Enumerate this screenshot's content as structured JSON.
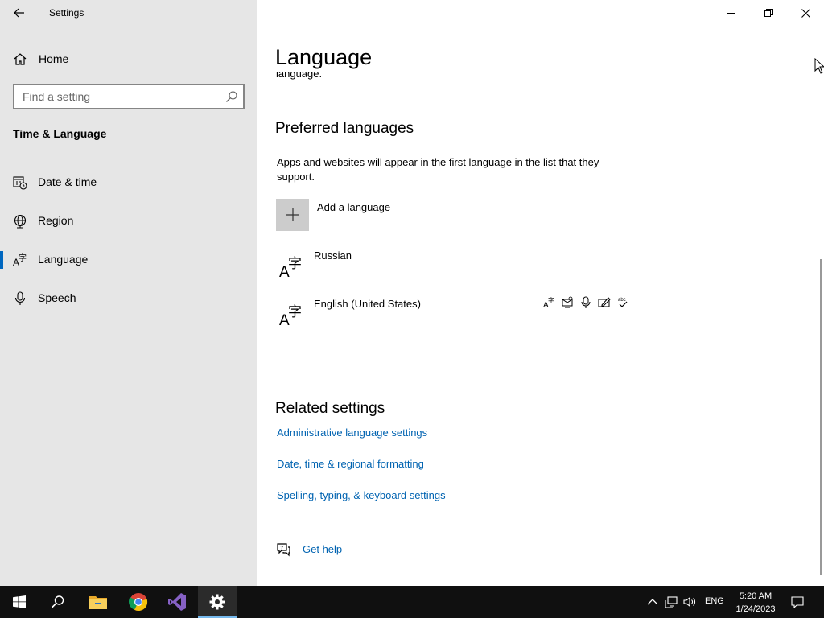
{
  "window": {
    "app_title": "Settings"
  },
  "sidebar": {
    "home_label": "Home",
    "search_placeholder": "Find a setting",
    "section_title": "Time & Language",
    "items": [
      {
        "label": "Date & time",
        "icon": "calendar-clock-icon"
      },
      {
        "label": "Region",
        "icon": "globe-icon"
      },
      {
        "label": "Language",
        "icon": "language-icon",
        "selected": true
      },
      {
        "label": "Speech",
        "icon": "microphone-icon"
      }
    ]
  },
  "main": {
    "page_title": "Language",
    "clipped_text": "language.",
    "preferred": {
      "heading": "Preferred languages",
      "description": "Apps and websites will appear in the first language in the list that they support.",
      "add_label": "Add a language",
      "languages": [
        {
          "name": "Russian"
        },
        {
          "name": "English (United States)",
          "features": [
            "display-language-icon",
            "text-to-speech-icon",
            "speech-recognition-icon",
            "handwriting-icon",
            "spell-check-icon"
          ]
        }
      ]
    },
    "related": {
      "heading": "Related settings",
      "links": [
        "Administrative language settings",
        "Date, time & regional formatting",
        "Spelling, typing, & keyboard settings"
      ]
    },
    "help_label": "Get help"
  },
  "taskbar": {
    "apps": [
      "start-icon",
      "search-icon",
      "file-explorer-icon",
      "chrome-icon",
      "visual-studio-icon",
      "settings-gear-icon"
    ],
    "active_app": "settings-gear-icon",
    "language": "ENG",
    "time": "5:20 AM",
    "date": "1/24/2023"
  },
  "colors": {
    "sidebar_bg": "#e6e6e6",
    "accent": "#0067c0",
    "link": "#0063b1",
    "taskbar_bg": "#101010"
  }
}
